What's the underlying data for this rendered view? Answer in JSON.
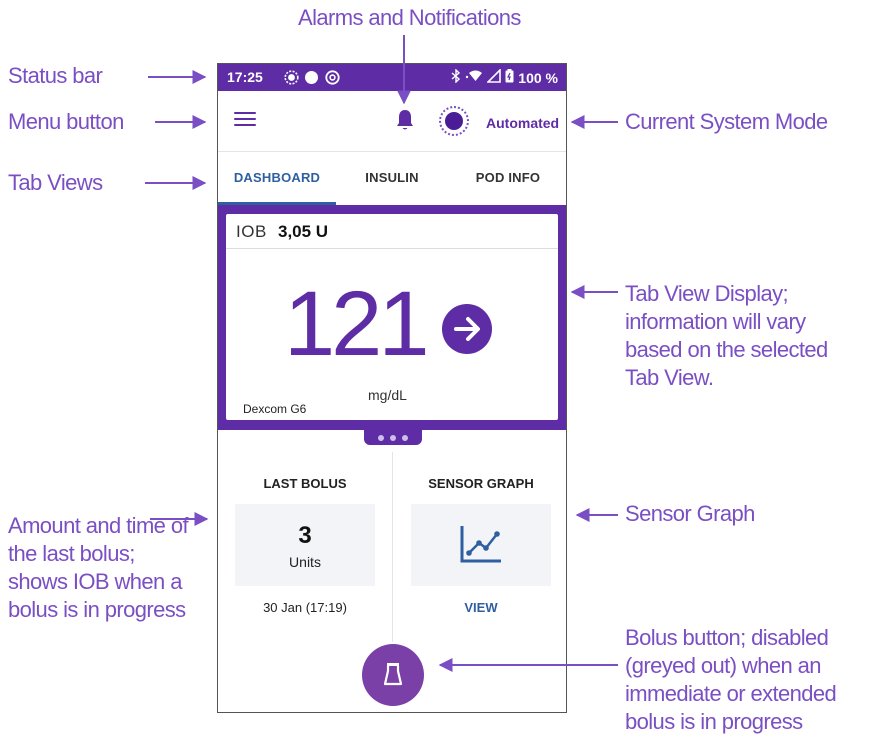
{
  "callouts": {
    "alarms": "Alarms and Notifications",
    "status_bar": "Status bar",
    "menu_button": "Menu button",
    "tab_views": "Tab Views",
    "system_mode": "Current System Mode",
    "tab_view_display": "Tab View Display; information will vary based on the selected Tab View.",
    "amount_time": "Amount and time of the last bolus; shows IOB when a bolus is in progress",
    "sensor_graph": "Sensor Graph",
    "bolus_button": "Bolus button; disabled (greyed out) when an immediate or extended bolus is in progress"
  },
  "status_bar": {
    "time": "17:25",
    "battery": "100 %",
    "icons": [
      "notification-icon",
      "circle-icon",
      "at-icon",
      "bluetooth-icon",
      "wifi-icon",
      "signal-icon",
      "battery-icon"
    ]
  },
  "app_bar": {
    "mode_label": "Automated",
    "icons": [
      "menu-icon",
      "bell-icon",
      "mode-icon"
    ]
  },
  "tabs": [
    {
      "label": "DASHBOARD",
      "active": true
    },
    {
      "label": "INSULIN",
      "active": false
    },
    {
      "label": "POD INFO",
      "active": false
    }
  ],
  "dashboard": {
    "iob_label": "IOB",
    "iob_value": "3,05 U",
    "glucose": "121",
    "glucose_unit": "mg/dL",
    "sensor_name": "Dexcom G6",
    "trend_icon": "arrow-right-icon",
    "page_count": 3
  },
  "last_bolus": {
    "title": "LAST BOLUS",
    "amount": "3",
    "unit": "Units",
    "time": "30 Jan (17:19)"
  },
  "sensor_graph": {
    "title": "SENSOR GRAPH",
    "link": "VIEW",
    "icon": "line-chart-icon"
  },
  "bolus_fab": {
    "icon": "pod-icon"
  },
  "colors": {
    "purple": "#5e2ca5",
    "callout": "#7b4fc4",
    "blue": "#2f5fa0"
  }
}
